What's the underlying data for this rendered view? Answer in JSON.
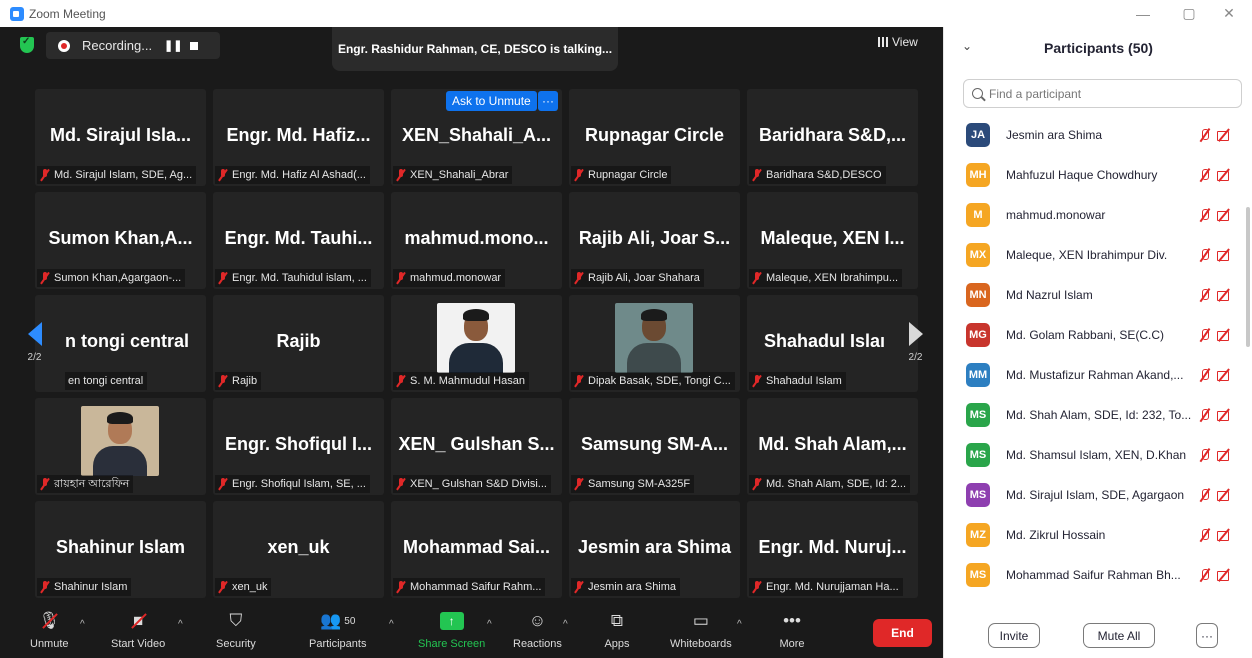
{
  "window": {
    "title": "Zoom Meeting"
  },
  "meeting": {
    "recording_label": "Recording...",
    "talking_banner": "Engr. Rashidur Rahman, CE, DESCO is talking...",
    "view_label": "View",
    "ask_to_unmute": "Ask to Unmute",
    "more_label": "···",
    "page_indicator_left": "2/2",
    "page_indicator_right": "2/2",
    "tiles": [
      {
        "name": "Md. Sirajul Isla...",
        "label": "Md. Sirajul Islam, SDE, Ag..."
      },
      {
        "name": "Engr. Md. Hafiz...",
        "label": "Engr. Md. Hafiz Al Ashad(..."
      },
      {
        "name": "XEN_Shahali_A...",
        "label": "XEN_Shahali_Abrar"
      },
      {
        "name": "Rupnagar Circle",
        "label": "Rupnagar Circle"
      },
      {
        "name": "Baridhara S&D,...",
        "label": "Baridhara S&D,DESCO"
      },
      {
        "name": "Sumon Khan,A...",
        "label": "Sumon Khan,Agargaon-..."
      },
      {
        "name": "Engr. Md. Tauhi...",
        "label": "Engr. Md. Tauhidul islam, ..."
      },
      {
        "name": "mahmud.mono...",
        "label": "mahmud.monowar"
      },
      {
        "name": "Rajib Ali, Joar S...",
        "label": "Rajib Ali, Joar Shahara"
      },
      {
        "name": "Maleque, XEN I...",
        "label": "Maleque, XEN Ibrahimpu..."
      },
      {
        "name": "n tongi central",
        "label": "en tongi central"
      },
      {
        "name": "Rajib",
        "label": "Rajib"
      },
      {
        "name": "",
        "label": "S. M. Mahmudul Hasan"
      },
      {
        "name": "",
        "label": "Dipak Basak, SDE, Tongi C..."
      },
      {
        "name": "Shahadul Islaı",
        "label": "Shahadul Islam"
      },
      {
        "name": "",
        "label": "রায়হান আরেফিন"
      },
      {
        "name": "Engr. Shofiqul I...",
        "label": "Engr. Shofiqul Islam, SE, ..."
      },
      {
        "name": "XEN_ Gulshan S...",
        "label": "XEN_ Gulshan S&D Divisi..."
      },
      {
        "name": "Samsung SM-A...",
        "label": "Samsung SM-A325F"
      },
      {
        "name": "Md. Shah Alam,...",
        "label": "Md. Shah Alam, SDE, Id: 2..."
      },
      {
        "name": "Shahinur Islam",
        "label": "Shahinur Islam"
      },
      {
        "name": "xen_uk",
        "label": "xen_uk"
      },
      {
        "name": "Mohammad Sai...",
        "label": "Mohammad Saifur Rahm..."
      },
      {
        "name": "Jesmin ara Shima",
        "label": "Jesmin ara Shima"
      },
      {
        "name": "Engr. Md. Nuruj...",
        "label": "Engr. Md. Nurujjaman Ha..."
      }
    ]
  },
  "toolbar": {
    "unmute": "Unmute",
    "start_video": "Start Video",
    "security": "Security",
    "participants": "Participants",
    "participants_count": "50",
    "share_screen": "Share Screen",
    "reactions": "Reactions",
    "apps": "Apps",
    "whiteboards": "Whiteboards",
    "more": "More",
    "end": "End"
  },
  "panel": {
    "title": "Participants (50)",
    "search_placeholder": "Find a participant",
    "participants": [
      {
        "initials": "JA",
        "name": "Jesmin ara Shima",
        "color": "#2b4a7a"
      },
      {
        "initials": "MH",
        "name": "Mahfuzul Haque Chowdhury",
        "color": "#f5a623"
      },
      {
        "initials": "M",
        "name": "mahmud.monowar",
        "color": "#f5a623"
      },
      {
        "initials": "MX",
        "name": "Maleque, XEN Ibrahimpur Div.",
        "color": "#f5a623"
      },
      {
        "initials": "MN",
        "name": "Md Nazrul Islam",
        "color": "#d9661f"
      },
      {
        "initials": "MG",
        "name": "Md. Golam Rabbani, SE(C.C)",
        "color": "#c8352d"
      },
      {
        "initials": "MM",
        "name": "Md. Mustafizur Rahman Akand,...",
        "color": "#2d7fc1"
      },
      {
        "initials": "MS",
        "name": "Md. Shah Alam, SDE, Id: 232, To...",
        "color": "#2aa54a"
      },
      {
        "initials": "MS",
        "name": "Md. Shamsul Islam, XEN, D.Khan",
        "color": "#2aa54a"
      },
      {
        "initials": "MS",
        "name": "Md. Sirajul Islam, SDE, Agargaon",
        "color": "#8e3fb0"
      },
      {
        "initials": "MZ",
        "name": "Md. Zikrul Hossain",
        "color": "#f5a623"
      },
      {
        "initials": "MS",
        "name": "Mohammad Saifur Rahman Bh...",
        "color": "#f5a623"
      }
    ],
    "invite": "Invite",
    "mute_all": "Mute All",
    "more": "···"
  }
}
